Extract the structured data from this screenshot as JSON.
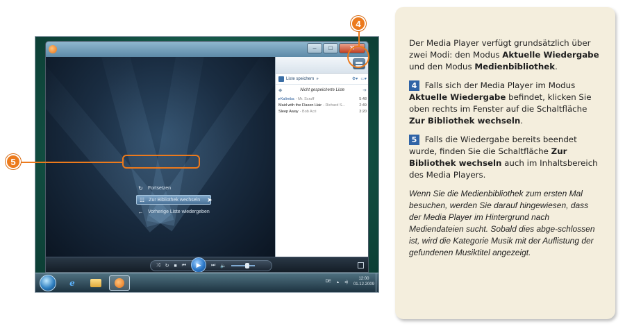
{
  "screenshot": {
    "list_pane": {
      "save_list_label": "Liste speichern",
      "playlist_title": "Nicht gespeicherte Liste",
      "tracks": [
        {
          "title": "Kalimba",
          "artist": "Mr. Scruff",
          "duration": "5:48"
        },
        {
          "title": "Maid with the Flaxen Hair",
          "artist": "Richard S...",
          "duration": "2:49"
        },
        {
          "title": "Sleep Away",
          "artist": "Bob Acri",
          "duration": "3:20"
        }
      ]
    },
    "stage_menu": {
      "resume": "Fortsetzen",
      "switch_library": "Zur Bibliothek wechseln",
      "play_previous": "Vorherige Liste wiedergeben"
    },
    "taskbar": {
      "language": "DE",
      "time": "12:00",
      "date": "01.12.2009"
    }
  },
  "callouts": {
    "four": "4",
    "five": "5"
  },
  "info": {
    "p1_a": "Der Media Player verfügt grundsätzlich über zwei Modi: den Modus ",
    "p1_b": "Aktuelle Wiedergabe",
    "p1_c": " und den Modus ",
    "p1_d": "Medienbibliothek",
    "p1_e": ".",
    "p2_num": "4",
    "p2_a": " Falls sich der Media Player im Modus ",
    "p2_b": "Aktuelle Wiedergabe",
    "p2_c": " befindet, klicken Sie oben rechts im Fenster auf die Schaltfläche ",
    "p2_d": "Zur Bibliothek wechseln",
    "p2_e": ".",
    "p3_num": "5",
    "p3_a": " Falls die Wiedergabe bereits beendet wurde, finden Sie die Schaltfläche ",
    "p3_b": "Zur Bibliothek wechseln",
    "p3_c": " auch im Inhaltsbereich des Media Players.",
    "note": "Wenn Sie die Medienbibliothek zum ersten Mal besuchen, werden Sie darauf hingewiesen, dass der Media Player im Hintergrund nach Mediendateien sucht. Sobald dies abge-schlossen ist, wird die Kategorie Musik mit der Auflistung der gefundenen Musiktitel angezeigt."
  }
}
